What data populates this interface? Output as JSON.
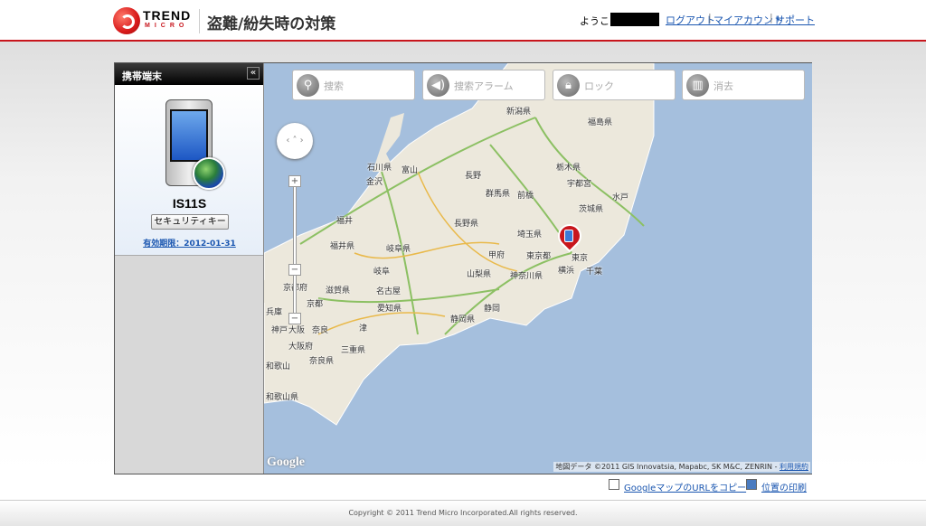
{
  "header": {
    "brand_line1": "TREND",
    "brand_line2": "MICRO",
    "title": "盗難/紛失時の対策",
    "welcome": "ようこそ",
    "links": [
      "ログアウト",
      "マイアカウント",
      "サポート"
    ]
  },
  "sidebar": {
    "title": "携帯端末",
    "collapse": "«",
    "device_name": "IS11S",
    "security_key_button": "セキュリティキー",
    "expiry": "有効期限：2012-01-31"
  },
  "actions": [
    {
      "label": "捜索",
      "icon": "location-pin-icon"
    },
    {
      "label": "捜索アラーム",
      "icon": "speaker-icon"
    },
    {
      "label": "ロック",
      "icon": "lock-icon"
    },
    {
      "label": "消去",
      "icon": "trash-icon"
    }
  ],
  "map": {
    "zoom_in": "+",
    "zoom_out": "−",
    "google_logo": "Google",
    "attribution": "地図データ ©2011 GIS Innovatsia, Mapabc, SK M&C, ZENRIN - ",
    "terms": "利用規約",
    "labels": [
      "新潟県",
      "福島県",
      "栃木県",
      "石川県",
      "富山",
      "金沢",
      "長野",
      "群馬県",
      "前橋",
      "宇都宮",
      "茨城県",
      "水戸",
      "福井",
      "長野県",
      "埼玉県",
      "福井県",
      "岐阜県",
      "甲府",
      "東京都",
      "東京",
      "千葉",
      "山梨県",
      "横浜",
      "神奈川県",
      "岐阜",
      "名古屋",
      "滋賀県",
      "京都府",
      "京都",
      "愛知県",
      "静岡",
      "静岡県",
      "神戸",
      "大阪",
      "奈良",
      "大阪府",
      "津",
      "三重県",
      "奈良県",
      "和歌山",
      "和歌山県",
      "兵庫"
    ]
  },
  "bottom_links": {
    "copy_url": "GoogleマップのURLをコピー",
    "print": "位置の印刷"
  },
  "footer": "Copyright © 2011 Trend Micro Incorporated.All rights reserved."
}
